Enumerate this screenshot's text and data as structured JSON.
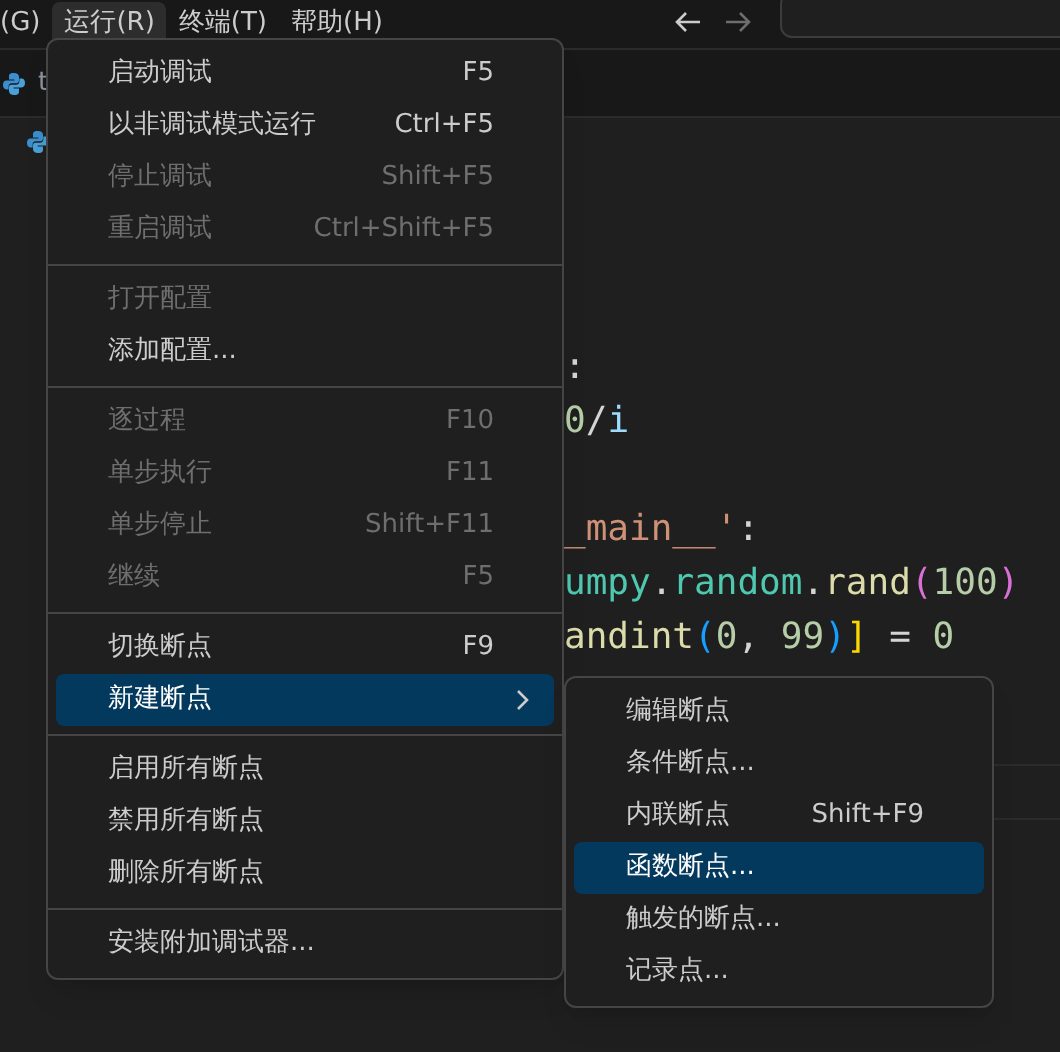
{
  "menubar": [
    {
      "label": "(G)",
      "selected": false
    },
    {
      "label": "运行(R)",
      "selected": true
    },
    {
      "label": "终端(T)",
      "selected": false
    },
    {
      "label": "帮助(H)",
      "selected": false
    }
  ],
  "tab": {
    "label": "t"
  },
  "code_blocks": [
    [
      {
        "tokens": [
          {
            "text": ":",
            "kind": "plain"
          }
        ]
      },
      {
        "tokens": [
          {
            "text": "0",
            "kind": "number"
          },
          {
            "text": "/",
            "kind": "plain"
          },
          {
            "text": "i",
            "kind": "variable"
          }
        ]
      }
    ],
    [
      {
        "tokens": [
          {
            "text": "_main__'",
            "kind": "string"
          },
          {
            "text": ":",
            "kind": "plain"
          }
        ]
      },
      {
        "tokens": [
          {
            "text": "umpy",
            "kind": "module"
          },
          {
            "text": ".",
            "kind": "plain"
          },
          {
            "text": "random",
            "kind": "module"
          },
          {
            "text": ".",
            "kind": "plain"
          },
          {
            "text": "rand",
            "kind": "function"
          },
          {
            "text": "(",
            "kind": "bracket2"
          },
          {
            "text": "100",
            "kind": "number"
          },
          {
            "text": ")",
            "kind": "bracket2"
          }
        ]
      },
      {
        "tokens": [
          {
            "text": "andint",
            "kind": "function"
          },
          {
            "text": "(",
            "kind": "bracket3"
          },
          {
            "text": "0",
            "kind": "number"
          },
          {
            "text": ", ",
            "kind": "plain"
          },
          {
            "text": "99",
            "kind": "number"
          },
          {
            "text": ")",
            "kind": "bracket3"
          },
          {
            "text": "]",
            "kind": "bracket1"
          },
          {
            "text": " = ",
            "kind": "plain"
          },
          {
            "text": "0",
            "kind": "number"
          }
        ]
      }
    ]
  ],
  "menu": {
    "groups": [
      [
        {
          "label": "启动调试",
          "shortcut": "F5",
          "disabled": false,
          "selected": false,
          "kind": "item"
        },
        {
          "label": "以非调试模式运行",
          "shortcut": "Ctrl+F5",
          "disabled": false,
          "selected": false,
          "kind": "item"
        },
        {
          "label": "停止调试",
          "shortcut": "Shift+F5",
          "disabled": true,
          "selected": false,
          "kind": "item"
        },
        {
          "label": "重启调试",
          "shortcut": "Ctrl+Shift+F5",
          "disabled": true,
          "selected": false,
          "kind": "item"
        }
      ],
      [
        {
          "label": "打开配置",
          "disabled": true,
          "selected": false,
          "kind": "item"
        },
        {
          "label": "添加配置...",
          "disabled": false,
          "selected": false,
          "kind": "item"
        }
      ],
      [
        {
          "label": "逐过程",
          "shortcut": "F10",
          "disabled": true,
          "selected": false,
          "kind": "item"
        },
        {
          "label": "单步执行",
          "shortcut": "F11",
          "disabled": true,
          "selected": false,
          "kind": "item"
        },
        {
          "label": "单步停止",
          "shortcut": "Shift+F11",
          "disabled": true,
          "selected": false,
          "kind": "item"
        },
        {
          "label": "继续",
          "shortcut": "F5",
          "disabled": true,
          "selected": false,
          "kind": "item"
        }
      ],
      [
        {
          "label": "切换断点",
          "shortcut": "F9",
          "disabled": false,
          "selected": false,
          "kind": "item"
        },
        {
          "label": "新建断点",
          "disabled": false,
          "selected": true,
          "kind": "submenu"
        }
      ],
      [
        {
          "label": "启用所有断点",
          "disabled": false,
          "selected": false,
          "kind": "item"
        },
        {
          "label": "禁用所有断点",
          "disabled": false,
          "selected": false,
          "kind": "item"
        },
        {
          "label": "删除所有断点",
          "disabled": false,
          "selected": false,
          "kind": "item"
        }
      ],
      [
        {
          "label": "安装附加调试器...",
          "disabled": false,
          "selected": false,
          "kind": "item"
        }
      ]
    ]
  },
  "submenu": {
    "items": [
      {
        "label": "编辑断点",
        "selected": false
      },
      {
        "label": "条件断点...",
        "selected": false
      },
      {
        "label": "内联断点",
        "shortcut": "Shift+F9",
        "selected": false
      },
      {
        "label": "函数断点...",
        "selected": true
      },
      {
        "label": "触发的断点...",
        "selected": false
      },
      {
        "label": "记录点...",
        "selected": false
      }
    ]
  }
}
